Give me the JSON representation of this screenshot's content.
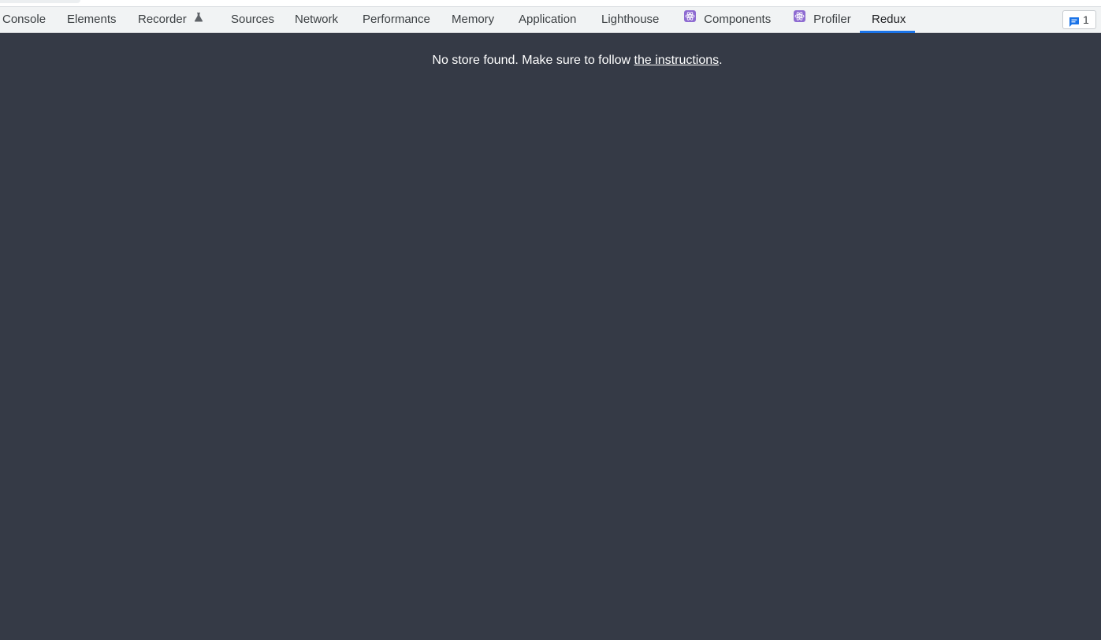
{
  "tabs": [
    {
      "id": "console",
      "label": "Console"
    },
    {
      "id": "elements",
      "label": "Elements"
    },
    {
      "id": "recorder",
      "label": "Recorder",
      "icon": "flask-icon"
    },
    {
      "id": "sources",
      "label": "Sources"
    },
    {
      "id": "network",
      "label": "Network"
    },
    {
      "id": "performance",
      "label": "Performance"
    },
    {
      "id": "memory",
      "label": "Memory"
    },
    {
      "id": "application",
      "label": "Application"
    },
    {
      "id": "lighthouse",
      "label": "Lighthouse"
    },
    {
      "id": "components",
      "label": "Components",
      "icon": "react-icon"
    },
    {
      "id": "profiler",
      "label": "Profiler",
      "icon": "react-icon"
    },
    {
      "id": "redux",
      "label": "Redux",
      "active": true
    }
  ],
  "issues": {
    "icon": "chat-bubble-icon",
    "count": "1"
  },
  "message": {
    "text_before": "No store found. Make sure to follow ",
    "link_text": "the instructions",
    "text_after": "."
  },
  "colors": {
    "panel_background": "#353a46",
    "tabbar_background": "#f1f3f4",
    "active_tab_underline": "#1a73e8",
    "react_icon": "#8e6bd1",
    "issues_icon": "#1a73e8"
  }
}
